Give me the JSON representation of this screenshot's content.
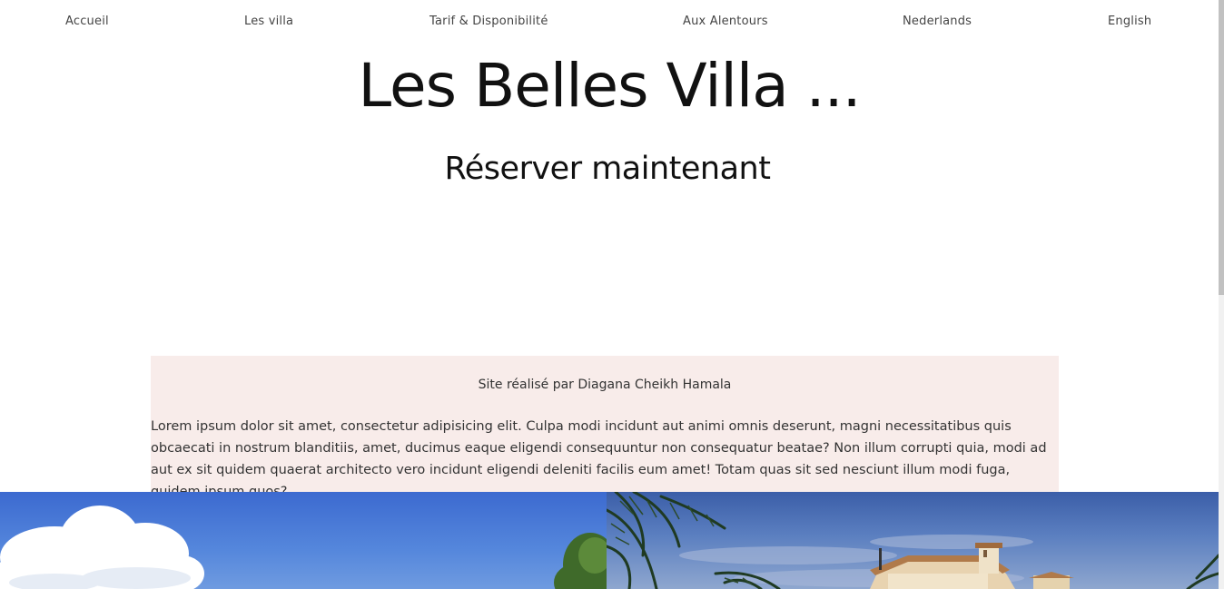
{
  "nav": {
    "items": [
      {
        "label": "Accueil"
      },
      {
        "label": "Les villa"
      },
      {
        "label": "Tarif & Disponibilité"
      },
      {
        "label": "Aux Alentours"
      },
      {
        "label": "Nederlands"
      },
      {
        "label": "English"
      }
    ]
  },
  "hero": {
    "title": "Les Belles Villa ...",
    "cta": "Réserver maintenant"
  },
  "info": {
    "credit": "Site réalisé par Diagana Cheikh Hamala",
    "text": "Lorem ipsum dolor sit amet, consectetur adipisicing elit. Culpa modi incidunt aut animi omnis deserunt, magni necessitatibus quis obcaecati in nostrum blanditiis, amet, ducimus eaque eligendi consequuntur non consequatur beatae? Non illum corrupti quia, modi ad aut ex sit quidem quaerat architecto vero incidunt eligendi deleniti facilis eum amet! Totam quas sit sed nesciunt illum modi fuga, quidem ipsum quos?"
  },
  "colors": {
    "info_background": "#f8ecea",
    "text": "#111111",
    "nav_text": "#444444"
  }
}
